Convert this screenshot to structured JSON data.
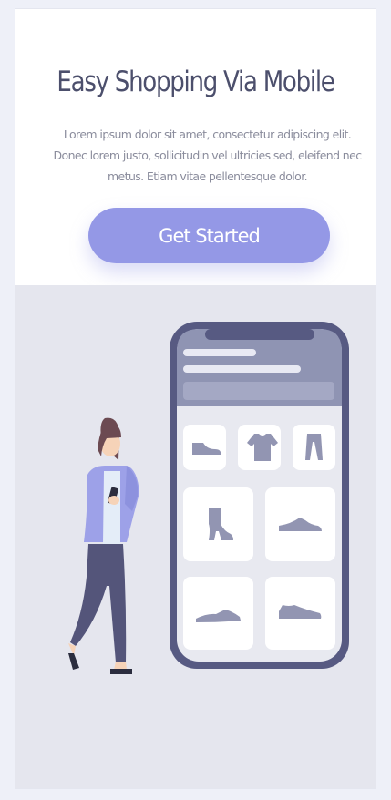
{
  "hero": {
    "title": "Easy Shopping Via Mobile",
    "description": "Lorem ipsum dolor sit amet, consectetur adipiscing elit. Donec lorem justo, sollicitudin vel ultricies sed, eleifend nec metus. Etiam vitae pellentesque dolor.",
    "cta_label": "Get Started"
  },
  "colors": {
    "page_background": "#eef0f8",
    "title": "#4c4f6c",
    "cta_background": "#9498e6",
    "illustration_background": "#e5e6ee",
    "phone_frame": "#575a82",
    "product_icon": "#9295b2"
  },
  "illustration": {
    "subject": "woman-holding-phone-next-to-shopping-app",
    "product_grid": [
      "flat-shoe-icon",
      "tshirt-icon",
      "pants-icon",
      "boot-icon",
      "sneaker-icon",
      "flat-shoe-icon",
      "sneaker-icon"
    ]
  }
}
